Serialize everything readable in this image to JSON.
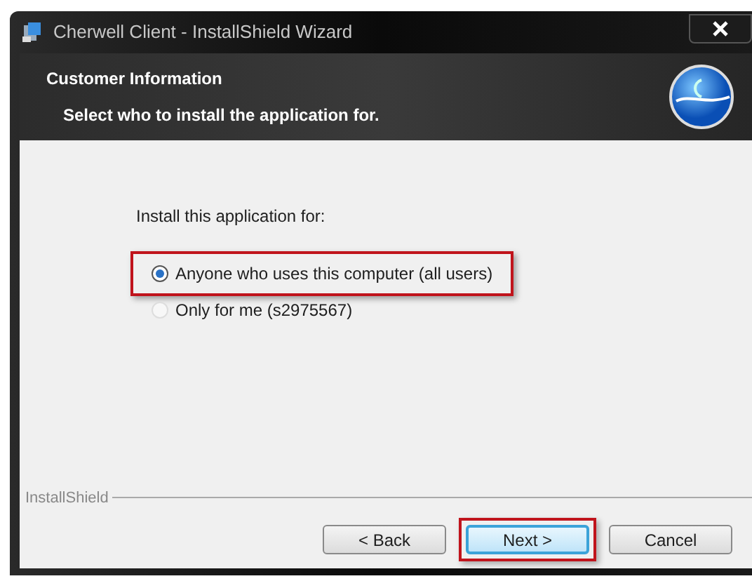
{
  "window": {
    "title": "Cherwell Client - InstallShield Wizard"
  },
  "header": {
    "title": "Customer Information",
    "subtitle": "Select who to install the application for."
  },
  "prompt": "Install this application for:",
  "options": [
    {
      "label": "Anyone who uses this computer (all users)",
      "selected": true,
      "highlighted": true
    },
    {
      "label": "Only for me (s2975567)",
      "selected": false,
      "highlighted": false
    }
  ],
  "footer_label": "InstallShield",
  "buttons": [
    {
      "label": "< Back",
      "default": false,
      "highlighted": false
    },
    {
      "label": "Next >",
      "default": true,
      "highlighted": true
    },
    {
      "label": "Cancel",
      "default": false,
      "highlighted": false
    }
  ]
}
